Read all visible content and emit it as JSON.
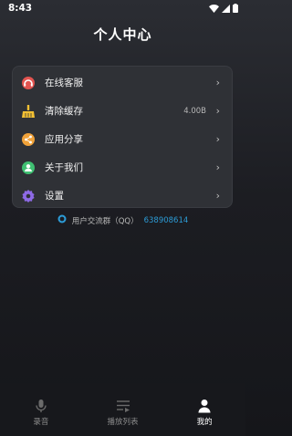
{
  "status_bar": {
    "time": "8:43",
    "icons": [
      "wifi-icon",
      "signal-icon",
      "battery-icon"
    ]
  },
  "header": {
    "title": "个人中心"
  },
  "menu": {
    "items": [
      {
        "label": "在线客服",
        "icon": "headset-icon",
        "value": "",
        "icon_color": "#e25450"
      },
      {
        "label": "清除缓存",
        "icon": "broom-icon",
        "value": "4.00B",
        "icon_color": "#f3c033"
      },
      {
        "label": "应用分享",
        "icon": "share-icon",
        "value": "",
        "icon_color": "#f0a23a"
      },
      {
        "label": "关于我们",
        "icon": "user-circle-icon",
        "value": "",
        "icon_color": "#3fbf72"
      },
      {
        "label": "设置",
        "icon": "gear-icon",
        "value": "",
        "icon_color": "#8e6ae6"
      }
    ]
  },
  "qq_group": {
    "label": "用户交流群（QQ）",
    "number": "638908614",
    "icon": "qq-icon",
    "accent": "#2c9bd6"
  },
  "tab_bar": {
    "tabs": [
      {
        "label": "录音",
        "icon": "microphone-icon",
        "active": false
      },
      {
        "label": "播放列表",
        "icon": "playlist-icon",
        "active": false
      },
      {
        "label": "我的",
        "icon": "person-icon",
        "active": true
      }
    ]
  },
  "colors": {
    "background": "#1c1d22",
    "card": "#2f3136",
    "text_primary": "#ffffff",
    "text_secondary": "#b8b8b8"
  }
}
